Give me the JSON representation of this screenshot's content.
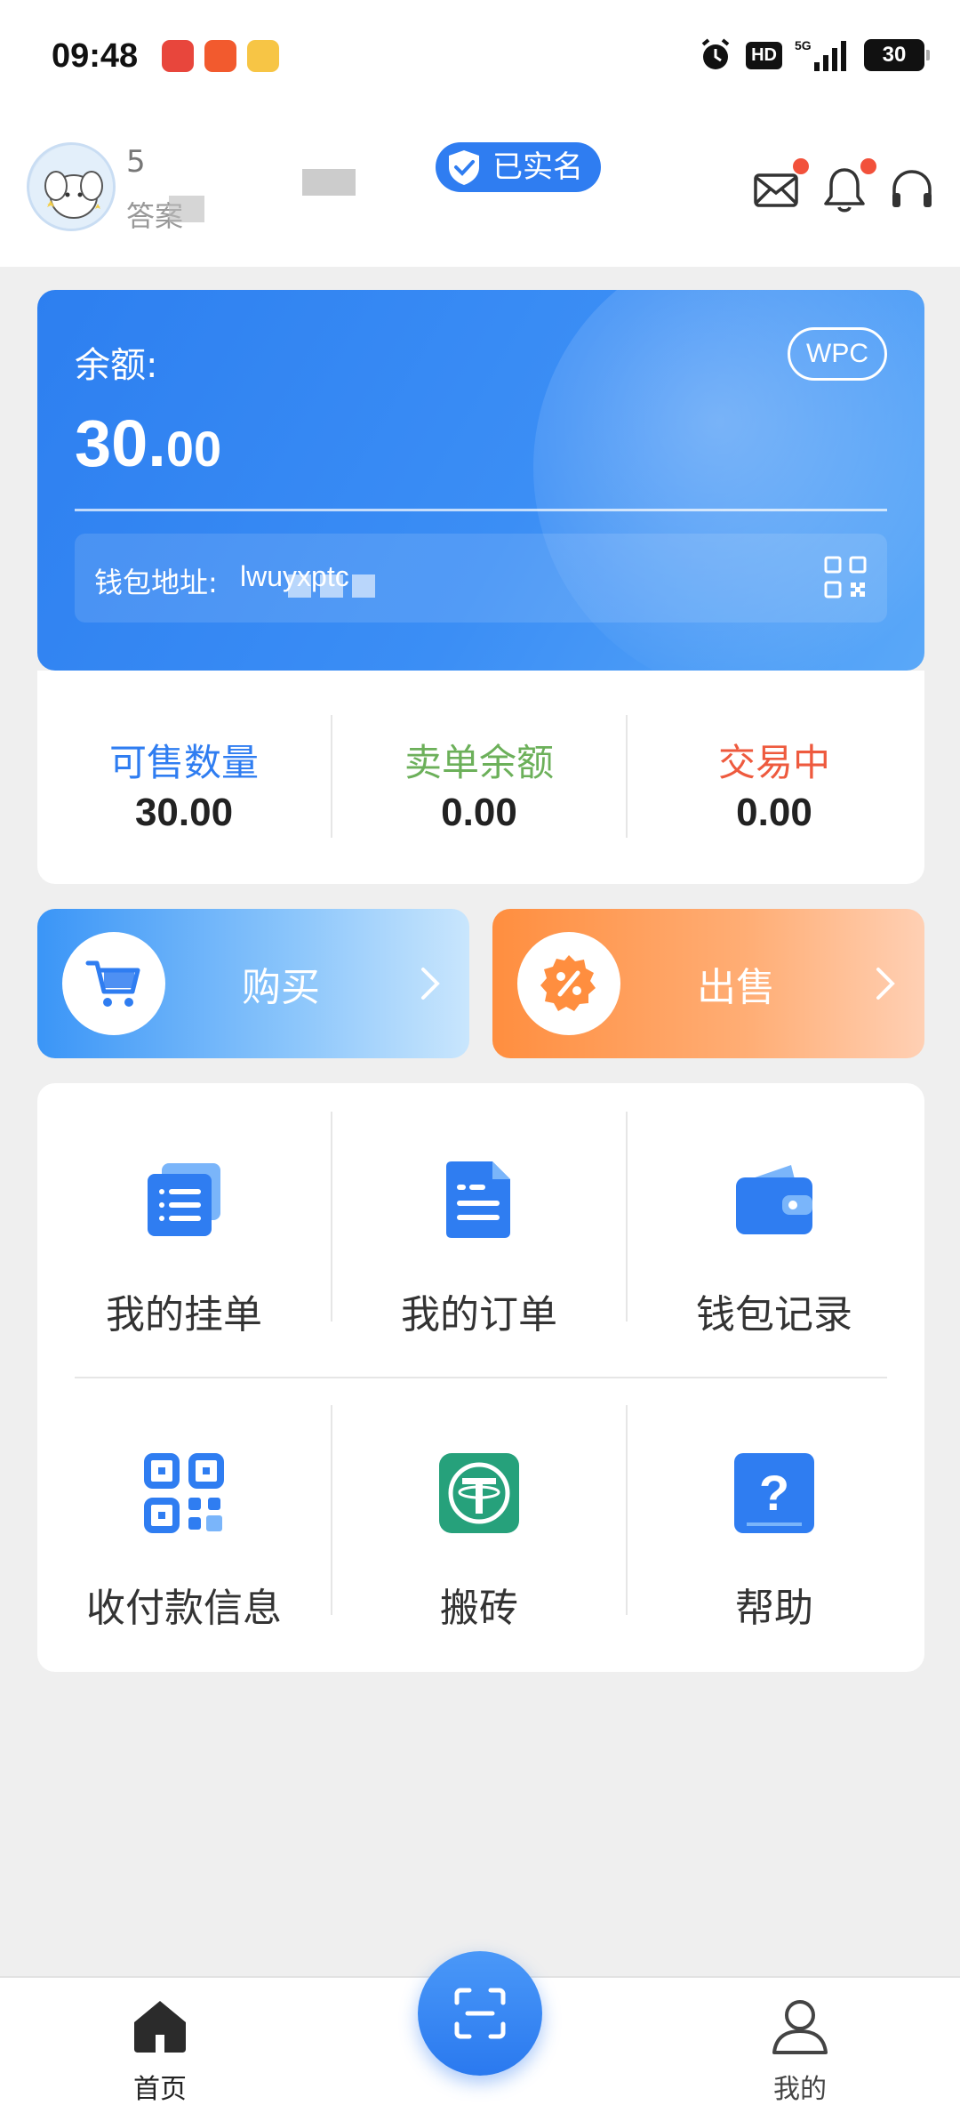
{
  "status_bar": {
    "time": "09:48",
    "network": "5G",
    "hd": "HD",
    "battery": "30"
  },
  "header": {
    "user_name": "5",
    "user_sub": "答案",
    "verified_label": "已实名"
  },
  "balance": {
    "label": "余额:",
    "value_int": "30.",
    "value_dec": "00",
    "currency": "WPC",
    "wallet_label": "钱包地址:",
    "wallet_address": "lwuyxptc"
  },
  "stats": [
    {
      "label": "可售数量",
      "value": "30.00",
      "color": "#2f7df1"
    },
    {
      "label": "卖单余额",
      "value": "0.00",
      "color": "#6cb05a"
    },
    {
      "label": "交易中",
      "value": "0.00",
      "color": "#ee5a3e"
    }
  ],
  "actions": {
    "buy_label": "购买",
    "sell_label": "出售"
  },
  "menu": [
    {
      "label": "我的挂单",
      "icon": "listing-icon"
    },
    {
      "label": "我的订单",
      "icon": "order-icon"
    },
    {
      "label": "钱包记录",
      "icon": "wallet-icon"
    },
    {
      "label": "收付款信息",
      "icon": "payment-qr-icon"
    },
    {
      "label": "搬砖",
      "icon": "tether-icon"
    },
    {
      "label": "帮助",
      "icon": "help-icon"
    }
  ],
  "bottom_nav": {
    "home_label": "首页",
    "mine_label": "我的"
  },
  "colors": {
    "primary": "#2f7df1",
    "sell": "#ff8e3f",
    "alert": "#f2513b",
    "tether": "#26a17b"
  }
}
